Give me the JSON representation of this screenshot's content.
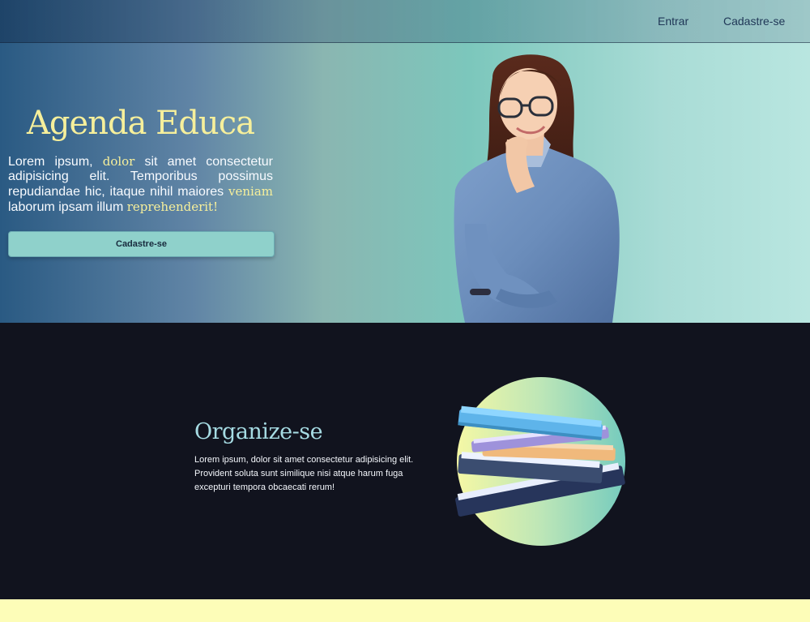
{
  "nav": {
    "login_label": "Entrar",
    "signup_label": "Cadastre-se"
  },
  "hero": {
    "title": "Agenda Educa",
    "text_1": "Lorem ipsum, ",
    "highlight_1": "dolor",
    "text_2": " sit amet consectetur adipisicing elit. Temporibus possimus repudiandae hic, itaque nihil maiores ",
    "highlight_2": "veniam",
    "text_3": " laborum ipsam illum ",
    "highlight_3": "reprehenderit!",
    "button_label": "Cadastre-se"
  },
  "organize": {
    "title": "Organize-se",
    "text": "Lorem ipsum, dolor sit amet consectetur adipisicing elit. Provident soluta sunt similique nisi atque harum fuga excepturi tempora obcaecati rerum!"
  },
  "colors": {
    "highlight": "#f6ef9b",
    "button": "#8fd1cb",
    "dark_section": "#11131e",
    "footer_strip": "#fdfdb8"
  }
}
